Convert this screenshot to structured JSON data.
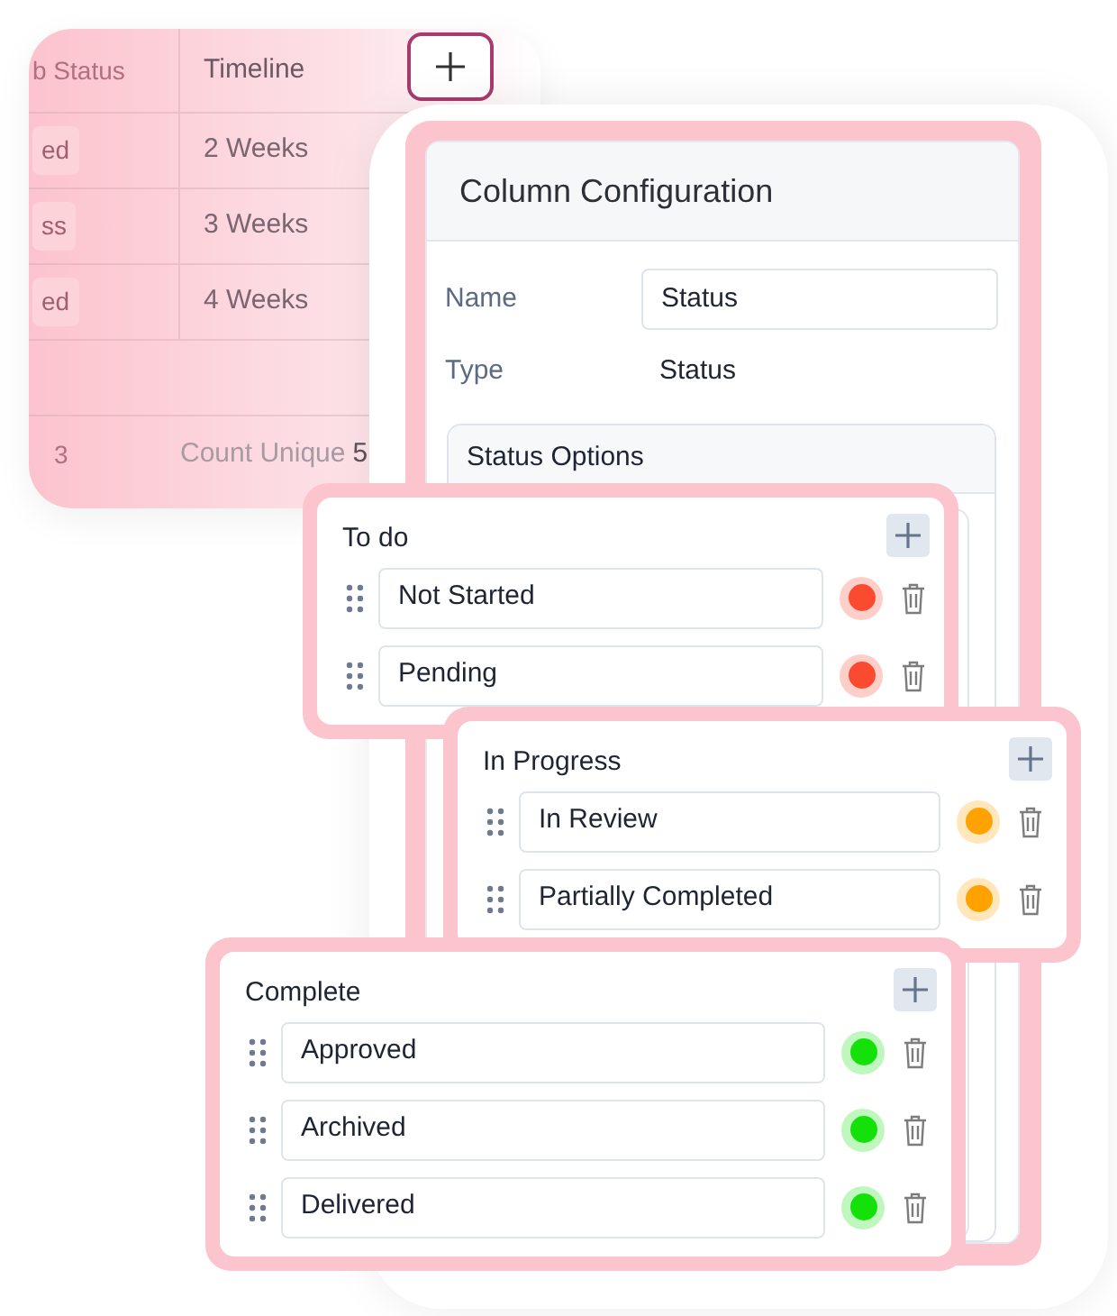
{
  "table": {
    "columns": [
      "b Status",
      "Timeline"
    ],
    "rows": [
      [
        "ed",
        "2 Weeks"
      ],
      [
        "ss",
        "3 Weeks"
      ],
      [
        "ed",
        "4 Weeks"
      ]
    ],
    "footer": {
      "column_1": "3",
      "count_label": "Count Unique",
      "count_value": "5"
    }
  },
  "config": {
    "title": "Column Configuration",
    "fields": [
      {
        "label": "Name",
        "kind": "input",
        "value": "Status"
      },
      {
        "label": "Type",
        "kind": "text",
        "value": "Status"
      }
    ],
    "status_options": {
      "title": "Status Options"
    }
  },
  "groups": [
    {
      "title": "To do",
      "options": [
        {
          "label": "Not Started",
          "color": "#fa4b31"
        },
        {
          "label": "Pending",
          "color": "#fa4b31"
        }
      ]
    },
    {
      "title": "In Progress",
      "options": [
        {
          "label": "In Review",
          "color": "#ffa200"
        },
        {
          "label": "Partially Completed",
          "color": "#ffa200"
        }
      ]
    },
    {
      "title": "Complete",
      "options": [
        {
          "label": "Approved",
          "color": "#14e10a"
        },
        {
          "label": "Archived",
          "color": "#14e10a"
        },
        {
          "label": "Delivered",
          "color": "#14e10a"
        }
      ]
    }
  ]
}
